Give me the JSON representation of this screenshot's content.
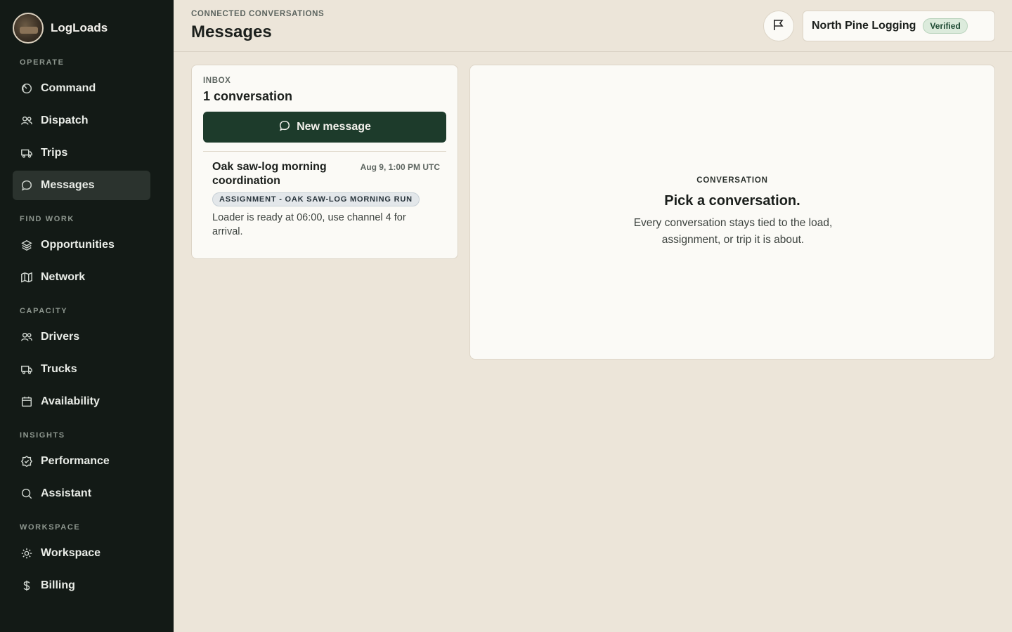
{
  "brand": {
    "name": "LogLoads",
    "logo_icon": "truck-logo"
  },
  "sidebar": {
    "sections": [
      {
        "label": "OPERATE"
      },
      {
        "label": "FIND WORK"
      },
      {
        "label": "CAPACITY"
      },
      {
        "label": "INSIGHTS"
      },
      {
        "label": "WORKSPACE"
      }
    ],
    "items": [
      {
        "label": "Command",
        "icon": "gauge-icon"
      },
      {
        "label": "Dispatch",
        "icon": "users-icon"
      },
      {
        "label": "Trips",
        "icon": "truck-icon"
      },
      {
        "label": "Messages",
        "icon": "chat-icon",
        "active": true
      },
      {
        "label": "Opportunities",
        "icon": "layers-icon"
      },
      {
        "label": "Network",
        "icon": "map-icon"
      },
      {
        "label": "Drivers",
        "icon": "users-icon"
      },
      {
        "label": "Trucks",
        "icon": "truck-icon"
      },
      {
        "label": "Availability",
        "icon": "calendar-icon"
      },
      {
        "label": "Performance",
        "icon": "badge-check-icon"
      },
      {
        "label": "Assistant",
        "icon": "search-icon"
      },
      {
        "label": "Workspace",
        "icon": "gear-icon"
      },
      {
        "label": "Billing",
        "icon": "dollar-icon"
      }
    ]
  },
  "header": {
    "eyebrow": "CONNECTED CONVERSATIONS",
    "title": "Messages",
    "flag_icon": "flag-icon",
    "org_name": "North Pine Logging",
    "org_badge": "Verified"
  },
  "inbox": {
    "label": "INBOX",
    "count_text": "1 conversation",
    "new_message_label": "New message",
    "conversations": [
      {
        "title": "Oak saw-log morning coordination",
        "time": "Aug 9, 1:00 PM UTC",
        "tag": "ASSIGNMENT - OAK SAW-LOG MORNING RUN",
        "preview": "Loader is ready at 06:00, use channel 4 for arrival."
      }
    ]
  },
  "conversation_panel": {
    "label": "CONVERSATION",
    "title": "Pick a conversation.",
    "subtitle": "Every conversation stays tied to the load, assignment, or trip it is about."
  },
  "colors": {
    "sidebar_bg": "#131a16",
    "page_bg": "#ece5d9",
    "primary_button": "#1d3b2b",
    "verified_bg": "#dcebdc"
  }
}
